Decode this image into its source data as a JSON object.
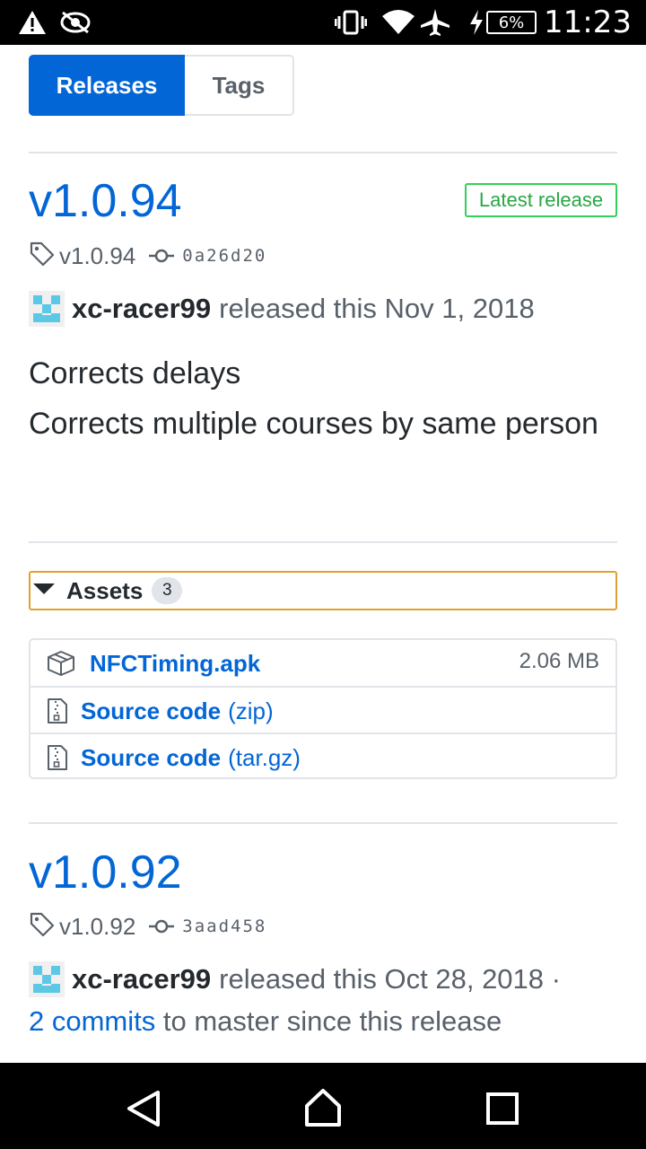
{
  "status_bar": {
    "time": "11:23",
    "battery": "6%",
    "icons": [
      "warning-icon",
      "eye-icon",
      "vibrate-icon",
      "wifi-icon",
      "airplane-icon",
      "charging-icon",
      "battery-icon"
    ]
  },
  "tabs": {
    "releases": "Releases",
    "tags": "Tags",
    "active": "Releases"
  },
  "releases": [
    {
      "version": "v1.0.94",
      "badge": "Latest release",
      "tag": "v1.0.94",
      "commit": "0a26d20",
      "author": "xc-racer99",
      "released_text": "released this Nov 1, 2018",
      "notes": [
        "Corrects delays",
        "Corrects multiple courses by same person"
      ],
      "assets": {
        "label": "Assets",
        "count": "3",
        "items": [
          {
            "name": "NFCTiming.apk",
            "suffix": "",
            "size": "2.06 MB",
            "icon": "package-icon"
          },
          {
            "name": "Source code",
            "suffix": "(zip)",
            "size": "",
            "icon": "file-zip-icon"
          },
          {
            "name": "Source code",
            "suffix": "(tar.gz)",
            "size": "",
            "icon": "file-zip-icon"
          }
        ]
      }
    },
    {
      "version": "v1.0.92",
      "tag": "v1.0.92",
      "commit": "3aad458",
      "author": "xc-racer99",
      "released_text": "released this Oct 28, 2018 ·",
      "commits_link": "2 commits",
      "commits_text": "to master since this release"
    }
  ],
  "colors": {
    "accent": "#0366d6",
    "badge_green": "#28a745",
    "focus_outline": "#e1a030",
    "muted": "#586069"
  },
  "nav_bar": {
    "icons": [
      "back-icon",
      "home-icon",
      "recents-icon"
    ]
  }
}
